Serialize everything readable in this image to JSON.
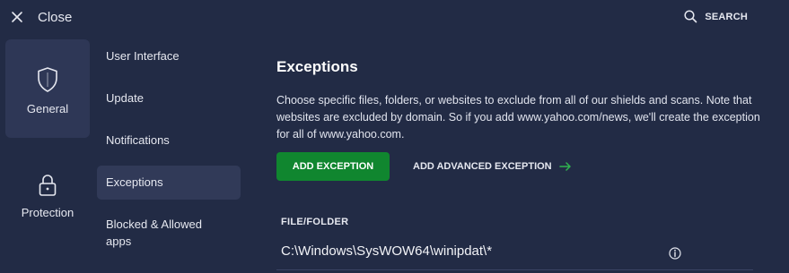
{
  "header": {
    "close_label": "Close",
    "search_label": "SEARCH"
  },
  "categories": [
    {
      "label": "General",
      "icon": "shield-icon",
      "active": true
    },
    {
      "label": "Protection",
      "icon": "lock-icon",
      "active": false
    }
  ],
  "subnav": [
    {
      "label": "User Interface"
    },
    {
      "label": "Update"
    },
    {
      "label": "Notifications"
    },
    {
      "label": "Exceptions",
      "active": true
    },
    {
      "label": "Blocked & Allowed apps"
    }
  ],
  "main": {
    "title": "Exceptions",
    "description": "Choose specific files, folders, or websites to exclude from all of our shields and scans. Note that websites are excluded by domain. So if you add www.yahoo.com/news, we'll create the exception for all of www.yahoo.com.",
    "add_button": "ADD EXCEPTION",
    "advanced_button": "ADD ADVANCED EXCEPTION",
    "table": {
      "column_header": "FILE/FOLDER",
      "rows": [
        {
          "path": "C:\\Windows\\SysWOW64\\winipdat\\*"
        }
      ]
    }
  },
  "colors": {
    "background": "#222b45",
    "accent_green": "#10862f",
    "active_item": "#313a58"
  }
}
